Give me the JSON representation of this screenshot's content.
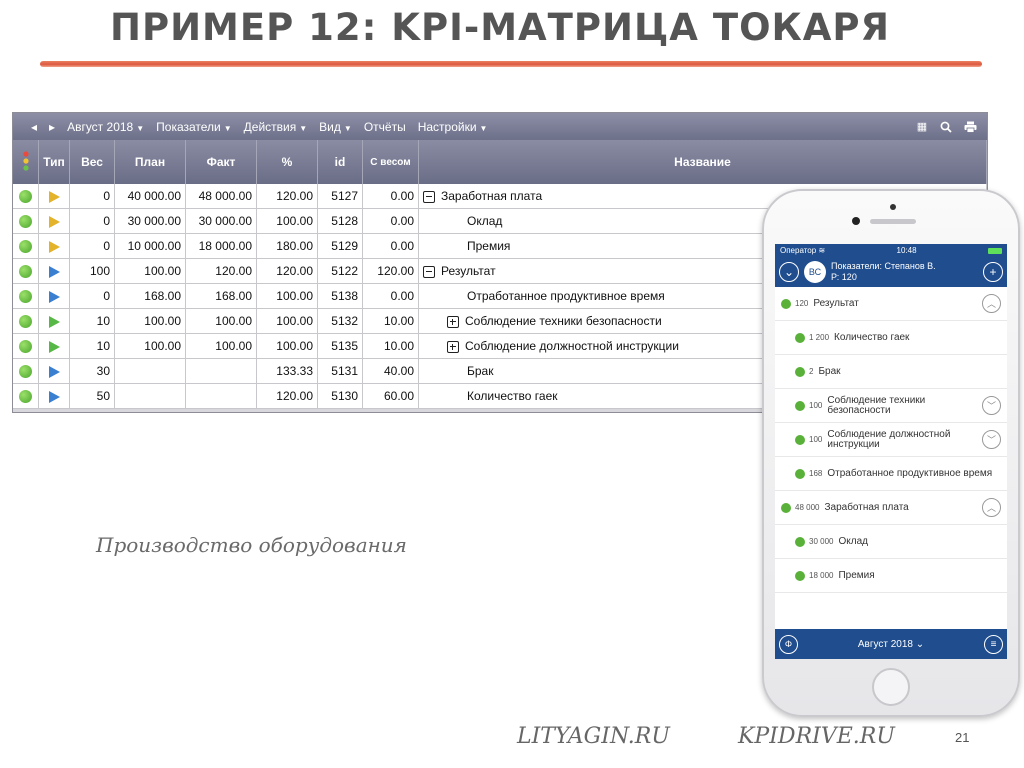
{
  "slide": {
    "title": "ПРИМЕР 12: KPI-МАТРИЦА ТОКАРЯ",
    "note": "Производство оборудования",
    "footer_left": "LITYAGIN.RU",
    "footer_right": "KPIDRIVE.RU",
    "page": "21"
  },
  "toolbar": {
    "period": "Август 2018",
    "menus": [
      "Показатели",
      "Действия",
      "Вид",
      "Отчёты",
      "Настройки"
    ]
  },
  "table": {
    "headers": {
      "type": "Тип",
      "weight": "Вес",
      "plan": "План",
      "fact": "Факт",
      "percent": "%",
      "id": "id",
      "weighted": "С весом",
      "name": "Название"
    },
    "rows": [
      {
        "weight": "0",
        "plan": "40 000.00",
        "fact": "48 000.00",
        "pct": "120.00",
        "id": "5127",
        "wv": "0.00",
        "name": "Заработная плата"
      },
      {
        "weight": "0",
        "plan": "30 000.00",
        "fact": "30 000.00",
        "pct": "100.00",
        "id": "5128",
        "wv": "0.00",
        "name": "Оклад"
      },
      {
        "weight": "0",
        "plan": "10 000.00",
        "fact": "18 000.00",
        "pct": "180.00",
        "id": "5129",
        "wv": "0.00",
        "name": "Премия"
      },
      {
        "weight": "100",
        "plan": "100.00",
        "fact": "120.00",
        "pct": "120.00",
        "id": "5122",
        "wv": "120.00",
        "name": "Результат"
      },
      {
        "weight": "0",
        "plan": "168.00",
        "fact": "168.00",
        "pct": "100.00",
        "id": "5138",
        "wv": "0.00",
        "name": "Отработанное продуктивное время"
      },
      {
        "weight": "10",
        "plan": "100.00",
        "fact": "100.00",
        "pct": "100.00",
        "id": "5132",
        "wv": "10.00",
        "name": "Соблюдение техники безопасности"
      },
      {
        "weight": "10",
        "plan": "100.00",
        "fact": "100.00",
        "pct": "100.00",
        "id": "5135",
        "wv": "10.00",
        "name": "Соблюдение должностной инструкции"
      },
      {
        "weight": "30",
        "plan": "",
        "fact": "",
        "pct": "133.33",
        "id": "5131",
        "wv": "40.00",
        "name": "Брак"
      },
      {
        "weight": "50",
        "plan": "",
        "fact": "",
        "pct": "120.00",
        "id": "5130",
        "wv": "60.00",
        "name": "Количество гаек"
      }
    ]
  },
  "phone": {
    "carrier": "Оператор",
    "time": "10:48",
    "avatar": "ВС",
    "header_line1": "Показатели: Степанов В.",
    "header_line2": "Р: 120",
    "items": [
      {
        "val": "120",
        "name": "Результат"
      },
      {
        "val": "1 200",
        "name": "Количество гаек"
      },
      {
        "val": "2",
        "name": "Брак"
      },
      {
        "val": "100",
        "name": "Соблюдение техники безопасности"
      },
      {
        "val": "100",
        "name": "Соблюдение должностной инструкции"
      },
      {
        "val": "168",
        "name": "Отработанное продуктивное время"
      },
      {
        "val": "48 000",
        "name": "Заработная плата"
      },
      {
        "val": "30 000",
        "name": "Оклад"
      },
      {
        "val": "18 000",
        "name": "Премия"
      }
    ],
    "bottom_period": "Август 2018"
  }
}
